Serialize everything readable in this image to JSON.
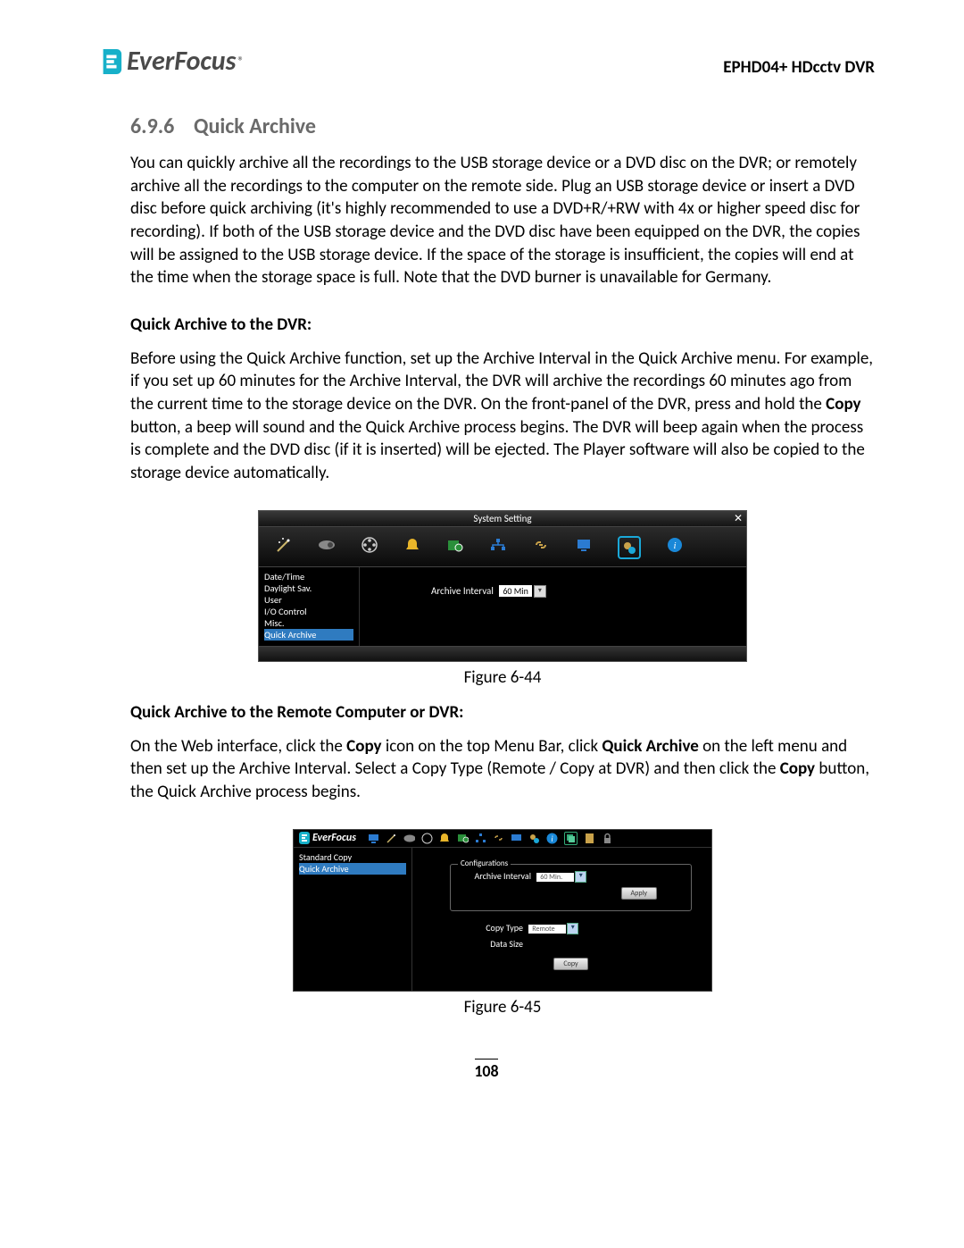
{
  "header": {
    "brand": "EverFocus",
    "reg": "®",
    "right": "EPHD04+  HDcctv DVR"
  },
  "section": {
    "number": "6.9.6",
    "title": "Quick Archive",
    "intro": "You can quickly archive all the recordings to the USB storage device or a DVD disc on the DVR; or remotely archive all the recordings to the computer on the remote side. Plug an USB storage device or insert a DVD disc before quick archiving (it's highly recommended to use a DVD+R/+RW with 4x or higher speed disc for recording). If both of the USB storage device and the DVD disc have been equipped on the DVR, the copies will be assigned to the USB storage device. If the space of the storage is insufficient, the copies will end at the time when the storage space is full. Note that the DVD burner is unavailable for Germany.",
    "sub1": "Quick Archive to the DVR:",
    "p1a": "Before using the Quick Archive function, set up the Archive Interval in the Quick Archive menu. For example, if you set up 60 minutes for the Archive Interval, the DVR will archive the recordings 60 minutes ago from the current time to the storage device on the DVR. On the front-panel of the DVR, press and hold the ",
    "p1b": " button, a beep will sound and the Quick Archive process begins. The DVR will beep again when the process is complete and the DVD disc (if it is inserted) will be ejected. The Player software will also be copied to the storage device automatically.",
    "copy_bold": "Copy",
    "sub2": "Quick Archive to the Remote Computer or DVR:",
    "p2a": "On the Web interface, click the ",
    "p2b": " icon on the top Menu Bar, click ",
    "p2c": " on the left menu and then set up the Archive Interval. Select a Copy Type (Remote / Copy at DVR) and then click the ",
    "p2d": " button, the Quick Archive process begins.",
    "qa_bold": "Quick Archive",
    "copy2_bold": "Copy",
    "copy3_bold": "Copy"
  },
  "fig44": {
    "title": "System Setting",
    "side": [
      "Date/Time",
      "Daylight Sav.",
      "User",
      "I/O Control",
      "Misc.",
      "Quick Archive"
    ],
    "label": "Archive Interval",
    "value": "60 Min",
    "caption": "Figure 6-44"
  },
  "fig45": {
    "brand": "EverFocus",
    "side": [
      "Standard Copy",
      "Quick Archive"
    ],
    "box_legend": "Configurations",
    "ai_label": "Archive Interval",
    "ai_value": "60 Min.",
    "apply": "Apply",
    "ct_label": "Copy Type",
    "ct_value": "Remote",
    "ds_label": "Data Size",
    "copy_btn": "Copy",
    "caption": "Figure 6-45"
  },
  "page_number": "108"
}
